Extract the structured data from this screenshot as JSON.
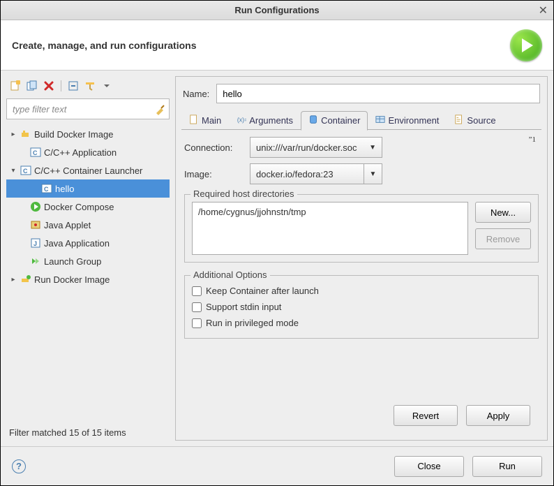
{
  "window": {
    "title": "Run Configurations"
  },
  "header": {
    "description": "Create, manage, and run configurations"
  },
  "filter": {
    "placeholder": "type filter text"
  },
  "tree": {
    "items": [
      {
        "label": "Build Docker Image",
        "caret": "▸",
        "indent": 0,
        "icon": "docker-build-icon"
      },
      {
        "label": "C/C++ Application",
        "caret": "",
        "indent": 1,
        "icon": "c-app-icon"
      },
      {
        "label": "C/C++ Container Launcher",
        "caret": "▾",
        "indent": 0,
        "icon": "c-app-icon"
      },
      {
        "label": "hello",
        "caret": "",
        "indent": 2,
        "icon": "c-app-icon",
        "selected": true
      },
      {
        "label": "Docker Compose",
        "caret": "",
        "indent": 1,
        "icon": "green-play-icon"
      },
      {
        "label": "Java Applet",
        "caret": "",
        "indent": 1,
        "icon": "java-applet-icon"
      },
      {
        "label": "Java Application",
        "caret": "",
        "indent": 1,
        "icon": "java-app-icon"
      },
      {
        "label": "Launch Group",
        "caret": "",
        "indent": 1,
        "icon": "launch-group-icon"
      },
      {
        "label": "Run Docker Image",
        "caret": "▸",
        "indent": 0,
        "icon": "docker-run-icon"
      }
    ]
  },
  "filter_status": "Filter matched 15 of 15 items",
  "name": {
    "label": "Name:",
    "value": "hello"
  },
  "tabs": {
    "items": [
      {
        "id": "main",
        "label": "Main",
        "icon": "main-tab-icon"
      },
      {
        "id": "arguments",
        "label": "Arguments",
        "icon": "arguments-tab-icon"
      },
      {
        "id": "container",
        "label": "Container",
        "icon": "container-tab-icon",
        "active": true
      },
      {
        "id": "environment",
        "label": "Environment",
        "icon": "environment-tab-icon"
      },
      {
        "id": "source",
        "label": "Source",
        "icon": "source-tab-icon"
      }
    ]
  },
  "container_form": {
    "connection_label": "Connection:",
    "connection_value": "unix:///var/run/docker.soc",
    "image_label": "Image:",
    "image_value": "docker.io/fedora:23",
    "quote_mark": "”1"
  },
  "required_dirs": {
    "legend": "Required host directories",
    "items": [
      "/home/cygnus/jjohnstn/tmp"
    ],
    "new_label": "New...",
    "remove_label": "Remove"
  },
  "additional_options": {
    "legend": "Additional Options",
    "items": [
      {
        "id": "keep",
        "label": "Keep Container after launch",
        "checked": false
      },
      {
        "id": "stdin",
        "label": "Support stdin input",
        "checked": false
      },
      {
        "id": "priv",
        "label": "Run in privileged mode",
        "checked": false
      }
    ]
  },
  "panel_buttons": {
    "revert": "Revert",
    "apply": "Apply"
  },
  "footer_buttons": {
    "close": "Close",
    "run": "Run"
  }
}
